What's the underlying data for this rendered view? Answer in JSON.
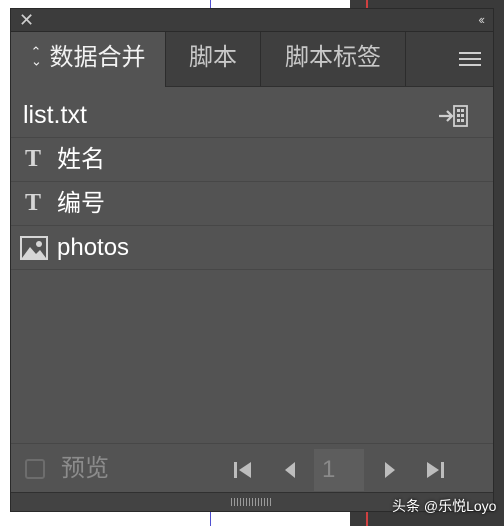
{
  "panel": {
    "tabs": [
      {
        "label": "数据合并",
        "active": true
      },
      {
        "label": "脚本",
        "active": false
      },
      {
        "label": "脚本标签",
        "active": false
      }
    ]
  },
  "data_source": {
    "file_name": "list.txt"
  },
  "fields": [
    {
      "label": "姓名",
      "icon": "text-T-icon"
    },
    {
      "label": "编号",
      "icon": "text-T-icon"
    },
    {
      "label": "photos",
      "icon": "image-icon"
    }
  ],
  "footer": {
    "preview_label": "预览",
    "preview_checked": false,
    "page_number": "1"
  },
  "watermark": "头条 @乐悦Loyo",
  "colors": {
    "panel_bg": "#535353",
    "tab_bar_bg": "#3f3f3f",
    "text": "#ffffff",
    "muted_text": "#8c8c8c"
  }
}
